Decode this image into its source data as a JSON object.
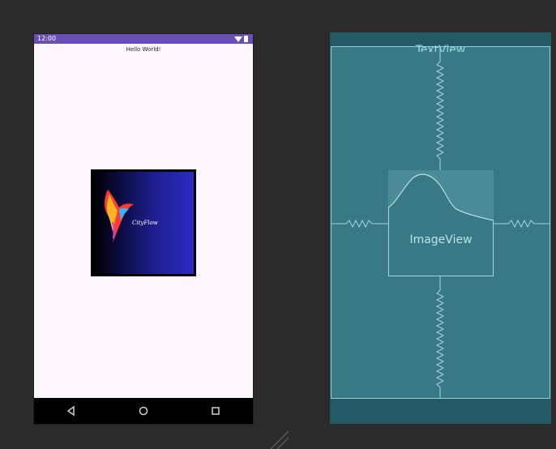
{
  "colors": {
    "background": "#2b2b2b",
    "status_bar": "#6a4fb3",
    "phone_screen": "#fdf6fd",
    "blueprint_dark": "#245a66",
    "blueprint_fill": "#397986",
    "blueprint_line": "#9fd6e0"
  },
  "design": {
    "status_time": "12:00",
    "status_icons": [
      "wifi-icon",
      "battery-icon"
    ],
    "screen_title": "Hello World!",
    "logo_text": "CityFlow",
    "nav_icons": [
      "back-icon",
      "home-icon",
      "recents-icon"
    ]
  },
  "blueprint": {
    "textview_label": "TextView",
    "imageview_label": "ImageView"
  }
}
